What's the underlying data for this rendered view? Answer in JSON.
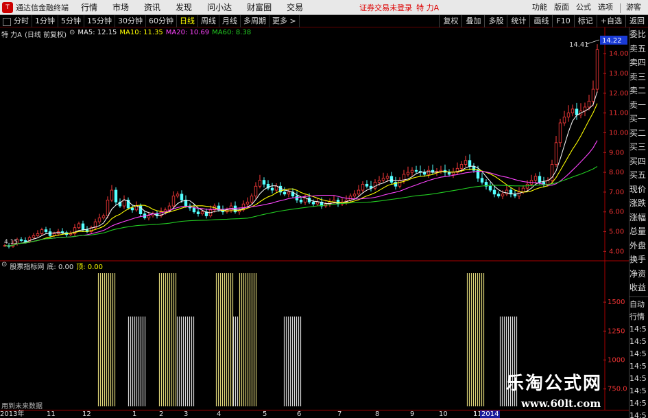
{
  "topbar": {
    "app_title": "通达信金融终端",
    "menus": [
      "行情",
      "市场",
      "资讯",
      "发现",
      "问小达",
      "财富圈",
      "交易"
    ],
    "status_text": "证券交易未登录",
    "stock_name": "特 力A",
    "right_menus": [
      "功能",
      "版面",
      "公式",
      "选项"
    ],
    "guest_label": "游客"
  },
  "periodbar": {
    "periods": [
      "分时",
      "1分钟",
      "5分钟",
      "15分钟",
      "30分钟",
      "60分钟",
      "日线",
      "周线",
      "月线",
      "多周期",
      "更多 >"
    ],
    "active_period": "日线",
    "tools": [
      "复权",
      "叠加",
      "多股",
      "统计",
      "画线",
      "F10",
      "标记",
      "+自选",
      "返回"
    ]
  },
  "main_legend": {
    "stock": "特 力A",
    "mode": "(日线 前复权)",
    "ma5": "MA5: 12.15",
    "ma10": "MA10: 11.35",
    "ma20": "MA20: 10.69",
    "ma60": "MA60: 8.38"
  },
  "sub_legend": {
    "name": "股票指标网",
    "bottom": "底: 0.00",
    "top": "顶: 0.00"
  },
  "price_axis": {
    "labels": [
      "14.00",
      "13.00",
      "12.00",
      "11.00",
      "10.00",
      "9.00",
      "8.00",
      "7.00",
      "6.00",
      "5.00",
      "4.00"
    ],
    "current_price": "14.22",
    "high_price": "14.41",
    "low_price": "4.15"
  },
  "volume_axis": {
    "labels": [
      "1500",
      "1250",
      "1000",
      "750.0"
    ]
  },
  "right_panel": {
    "items": [
      "委比",
      "卖五",
      "卖四",
      "卖三",
      "卖二",
      "卖一",
      "买一",
      "买二",
      "买三",
      "买四",
      "买五",
      "现价",
      "涨跌",
      "涨幅",
      "总量",
      "外盘",
      "换手",
      "净资",
      "收益"
    ],
    "sub_items": [
      "自动",
      "行情",
      "14:5",
      "14:5",
      "14:5",
      "14:5",
      "14:5",
      "14:5",
      "14:5",
      "14:5"
    ]
  },
  "time_axis": {
    "labels": [
      "2013年",
      "11",
      "12",
      "1",
      "2",
      "3",
      "4",
      "5",
      "6",
      "7",
      "8",
      "9",
      "10",
      "11",
      "1",
      "2014"
    ]
  },
  "future_text": "用到未来数据",
  "watermark": {
    "line1": "乐淘公式网",
    "line2": "www.60lt.com"
  },
  "chart_data": {
    "type": "candlestick",
    "ylim": [
      3.7,
      14.7
    ],
    "closes": [
      4.3,
      4.25,
      4.4,
      4.6,
      4.55,
      4.5,
      4.7,
      4.8,
      4.9,
      5.1,
      5.0,
      4.8,
      4.9,
      5.0,
      4.95,
      4.85,
      4.9,
      5.2,
      5.4,
      5.1,
      5.0,
      5.2,
      5.5,
      5.7,
      5.8,
      6.6,
      7.1,
      6.5,
      6.3,
      6.6,
      6.2,
      6.1,
      6.3,
      5.9,
      5.7,
      5.8,
      5.9,
      5.8,
      6.0,
      6.1,
      6.3,
      6.8,
      6.9,
      6.6,
      6.3,
      6.2,
      6.0,
      5.9,
      6.0,
      5.8,
      6.1,
      6.3,
      6.1,
      6.0,
      6.1,
      6.3,
      6.0,
      6.1,
      6.4,
      6.5,
      6.8,
      7.3,
      7.6,
      7.4,
      7.2,
      7.1,
      7.3,
      7.0,
      6.9,
      7.0,
      6.8,
      6.6,
      6.5,
      6.7,
      6.5,
      6.4,
      6.5,
      6.3,
      6.4,
      6.5,
      6.6,
      6.4,
      6.5,
      6.6,
      6.8,
      6.9,
      7.1,
      7.4,
      7.3,
      7.2,
      7.5,
      7.6,
      7.7,
      7.8,
      7.5,
      7.3,
      7.6,
      7.9,
      8.0,
      8.1,
      8.05,
      8.0,
      7.9,
      8.1,
      8.0,
      8.05,
      8.1,
      8.0,
      7.9,
      8.0,
      8.2,
      8.4,
      8.6,
      8.3,
      8.1,
      7.7,
      7.5,
      7.3,
      7.1,
      6.9,
      6.8,
      6.9,
      7.1,
      6.9,
      6.8,
      7.0,
      7.2,
      7.4,
      7.6,
      7.8,
      7.5,
      7.4,
      7.6,
      8.4,
      9.5,
      10.5,
      10.8,
      11.0,
      11.2,
      10.9,
      11.1,
      11.3,
      11.6,
      12.2,
      14.2
    ]
  },
  "indicator_data": {
    "type": "bar",
    "bars": [
      {
        "start": 143,
        "end": 167,
        "level": 1750,
        "color": "#e0d77a"
      },
      {
        "start": 187,
        "end": 211,
        "level": 1375,
        "color": "#d8d8d8"
      },
      {
        "start": 232,
        "end": 256,
        "level": 1750,
        "color": "#e0d77a"
      },
      {
        "start": 258,
        "end": 282,
        "level": 1375,
        "color": "#d8d8d8"
      },
      {
        "start": 315,
        "end": 339,
        "level": 1750,
        "color": "#e0d77a"
      },
      {
        "start": 340,
        "end": 346,
        "level": 1375,
        "color": "#d8d8d8"
      },
      {
        "start": 349,
        "end": 373,
        "level": 1750,
        "color": "#e0d77a"
      },
      {
        "start": 414,
        "end": 438,
        "level": 1375,
        "color": "#d8d8d8"
      },
      {
        "start": 681,
        "end": 705,
        "level": 1750,
        "color": "#e0d77a"
      },
      {
        "start": 729,
        "end": 753,
        "level": 1375,
        "color": "#d8d8d8"
      }
    ]
  }
}
